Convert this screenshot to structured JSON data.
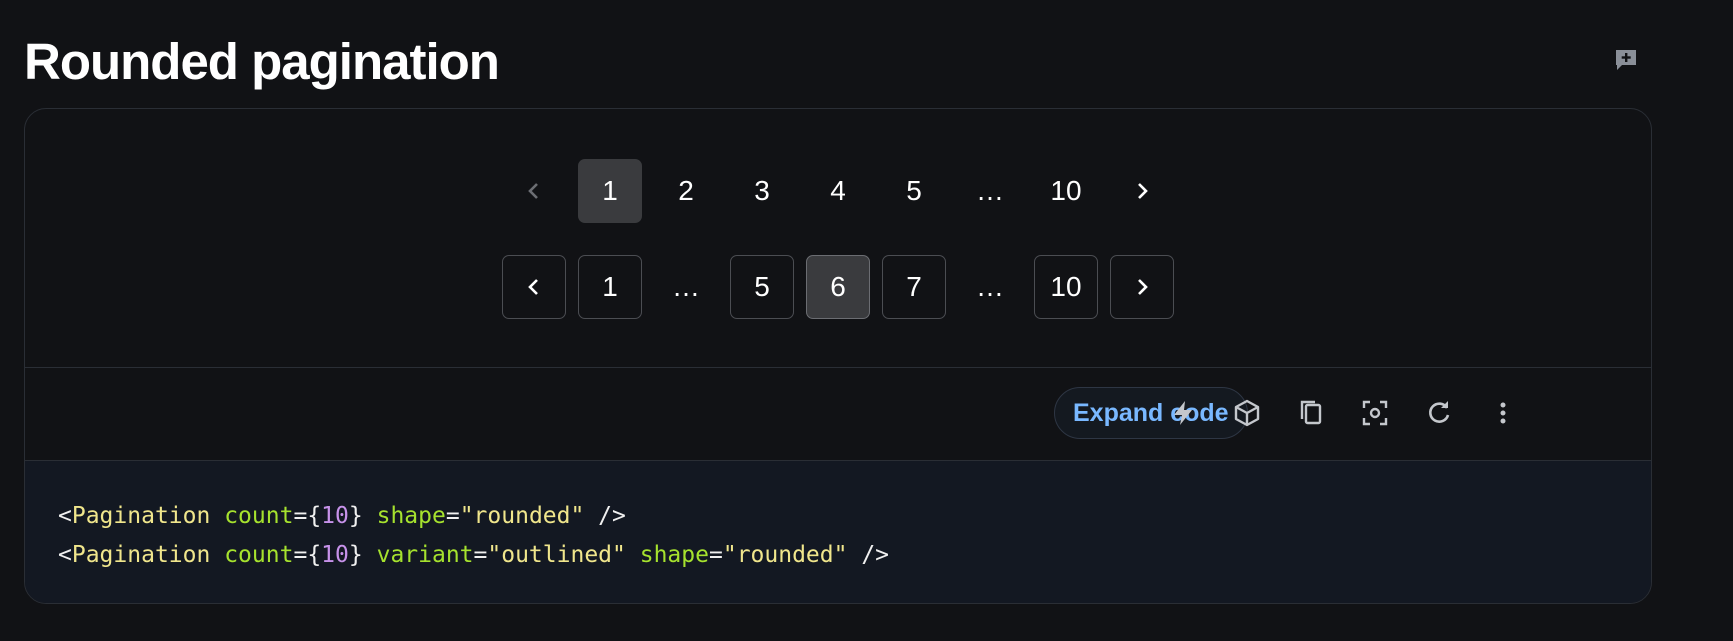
{
  "header": {
    "title": "Rounded pagination"
  },
  "demo": {
    "pager_text": {
      "prev_icon": "chevron-left-icon",
      "next_icon": "chevron-right-icon",
      "items": [
        "1",
        "2",
        "3",
        "4",
        "5",
        "…",
        "10"
      ],
      "selected": "1"
    },
    "pager_outlined": {
      "prev_icon": "chevron-left-icon",
      "next_icon": "chevron-right-icon",
      "items": [
        "1",
        "…",
        "5",
        "6",
        "7",
        "…",
        "10"
      ],
      "selected": "6"
    }
  },
  "toolbar": {
    "expand_label": "Expand code",
    "icons": [
      "bolt-icon",
      "cube-icon",
      "copy-icon",
      "screenshot-icon",
      "refresh-icon",
      "more-vertical-icon"
    ]
  },
  "code": {
    "line1": {
      "open": "<",
      "tag": "Pagination",
      "attr1": "count",
      "eq1": "=",
      "brace_open": "{",
      "num": "10",
      "brace_close": "}",
      "attr2": "shape",
      "eq2": "=",
      "str2": "\"rounded\"",
      "close": " />"
    },
    "line2": {
      "open": "<",
      "tag": "Pagination",
      "attr1": "count",
      "eq1": "=",
      "brace_open": "{",
      "num": "10",
      "brace_close": "}",
      "attr2": "variant",
      "eq2": "=",
      "str2": "\"outlined\"",
      "attr3": "shape",
      "eq3": "=",
      "str3": "\"rounded\"",
      "close": " />"
    }
  },
  "colors": {
    "background": "#111215",
    "accent": "#79b8ff",
    "selected": "#3a3b3e",
    "border": "#2a2e35"
  }
}
